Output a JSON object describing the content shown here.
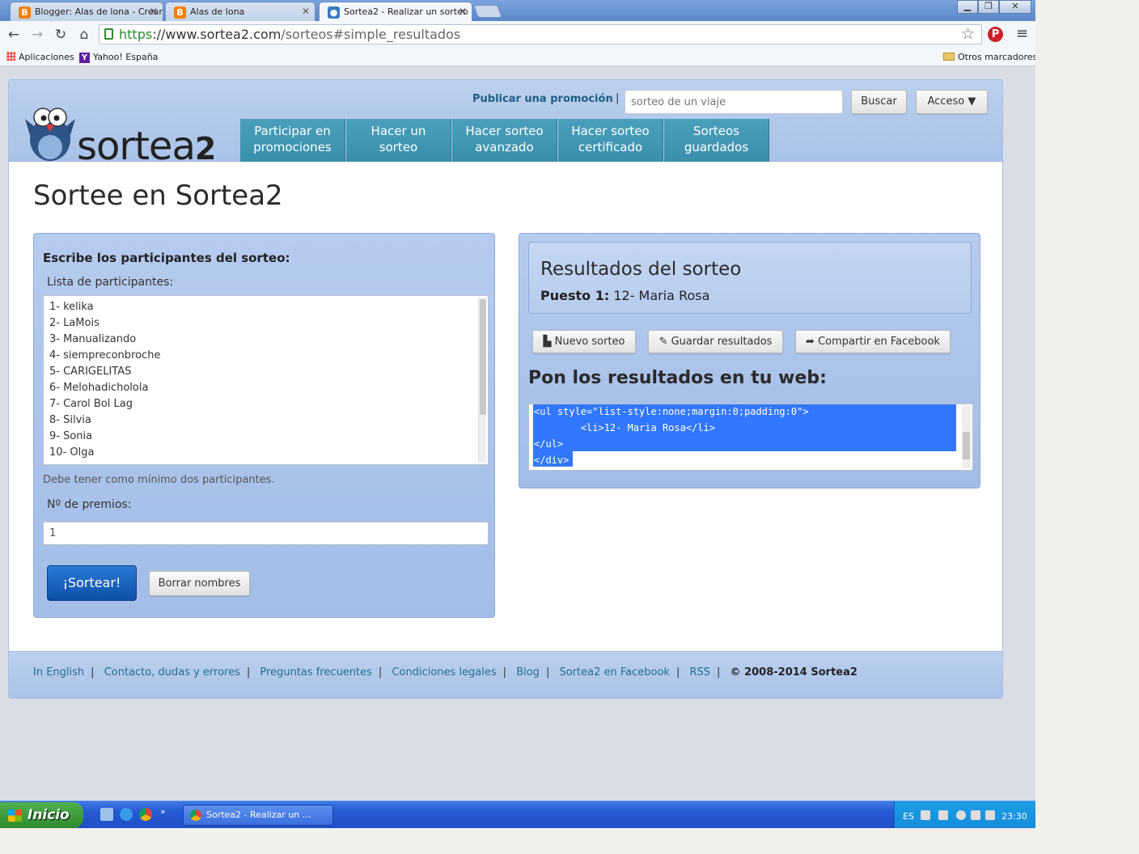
{
  "browser": {
    "tabs": [
      {
        "title": "Blogger: Alas de lona - Crear",
        "favicon": "blogger-icon"
      },
      {
        "title": "Alas de lona",
        "favicon": "blogger-icon"
      },
      {
        "title": "Sortea2 - Realizar un sorteo",
        "favicon": "sortea2-icon"
      }
    ],
    "window_controls": [
      "minimize",
      "restore",
      "close"
    ],
    "url": {
      "scheme": "https",
      "host": "://www.sortea2.com",
      "path": "/sorteos#simple_resultados"
    },
    "bookmarks": [
      "Aplicaciones",
      "Yahoo! España",
      "Otros marcadores"
    ]
  },
  "site": {
    "logo": "sortea2",
    "promo_link": "Publicar una promoción",
    "promo_sep": "|",
    "search_placeholder": "sorteo de un viaje",
    "search_button": "Buscar",
    "access_button": "Acceso ▼",
    "nav": [
      {
        "line1": "Participar en",
        "line2": "promociones"
      },
      {
        "line1": "Hacer un",
        "line2": "sorteo"
      },
      {
        "line1": "Hacer sorteo",
        "line2": "avanzado"
      },
      {
        "line1": "Hacer sorteo",
        "line2": "certificado"
      },
      {
        "line1": "Sorteos",
        "line2": "guardados"
      }
    ],
    "page_title": "Sortee en Sortea2",
    "form": {
      "heading": "Escribe los participantes del sorteo:",
      "list_label": "Lista de participantes:",
      "participants": [
        "1- kelika",
        "2- LaMois",
        "3- Manualizando",
        "4- siempreconbroche",
        "5- CARIGELITAS",
        "6- Melohadicholola",
        "7- Carol Bol Lag",
        "8- Silvia",
        "9- Sonia",
        "10- Olga"
      ],
      "min_note": "Debe tener como mínimo dos participantes.",
      "prizes_label": "Nº de premios:",
      "prizes_value": "1",
      "submit": "¡Sortear!",
      "clear": "Borrar nombres"
    },
    "results": {
      "title": "Resultados del sorteo",
      "winner_label": "Puesto 1:",
      "winner_value": "12- Maria Rosa",
      "new_draw": "Nuevo sorteo",
      "save": "Guardar resultados",
      "share": "Compartir en Facebook",
      "web_title": "Pon los resultados en tu web:",
      "code_lines": [
        "<ul style=\"list-style:none;margin:0;padding:0\">",
        "        <li>12- Maria Rosa</li>",
        "</ul>",
        "</div>"
      ]
    },
    "footer": {
      "links": [
        "In English",
        "Contacto, dudas y errores",
        "Preguntas frecuentes",
        "Condiciones legales",
        "Blog",
        "Sortea2 en Facebook",
        "RSS"
      ],
      "copyright": "© 2008-2014 Sortea2"
    }
  },
  "taskbar": {
    "start": "Inicio",
    "task": "Sortea2 - Realizar un ...",
    "lang": "ES",
    "clock": "23:30"
  },
  "colors": {
    "nav": "#3a8fab",
    "primary_button": "#0c4fa8",
    "header_bg": "#bcd0ee",
    "link": "#1e6f8e"
  }
}
